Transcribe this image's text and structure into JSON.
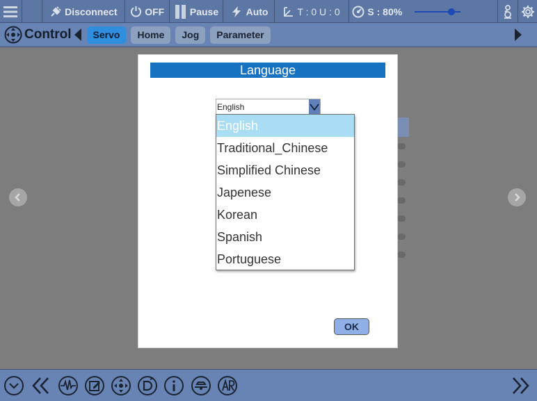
{
  "topbar": {
    "disconnect_label": "Disconnect",
    "power_label": "OFF",
    "pause_label": "Pause",
    "mode_label": "Auto",
    "tool_frame_label": "T : 0 U : 0",
    "speed_label": "S : 80%",
    "speed_value": 0.8
  },
  "control_bar": {
    "title": "Control",
    "tabs": [
      {
        "label": "Servo",
        "active": true
      },
      {
        "label": "Home",
        "active": false
      },
      {
        "label": "Jog",
        "active": false
      },
      {
        "label": "Parameter",
        "active": false
      }
    ]
  },
  "dialog": {
    "title": "Language",
    "selected_value": "English",
    "options": [
      "English",
      "Traditional_Chinese",
      "Simplified Chinese",
      "Japenese",
      "Korean",
      "Spanish",
      "Portuguese"
    ],
    "highlighted_index": 0,
    "ok_label": "OK"
  },
  "colors": {
    "bar_blue": "#5c77a3",
    "title_blue": "#1772c2",
    "active_tab": "#2f8fde",
    "option_highlight": "#a9ddf3"
  },
  "bottombar": {
    "icons": [
      "collapse-icon",
      "double-left-icon",
      "waveform-icon",
      "edit-icon",
      "move-icon",
      "io-icon",
      "info-icon",
      "tool-icon",
      "ar-icon",
      "double-right-icon"
    ]
  }
}
